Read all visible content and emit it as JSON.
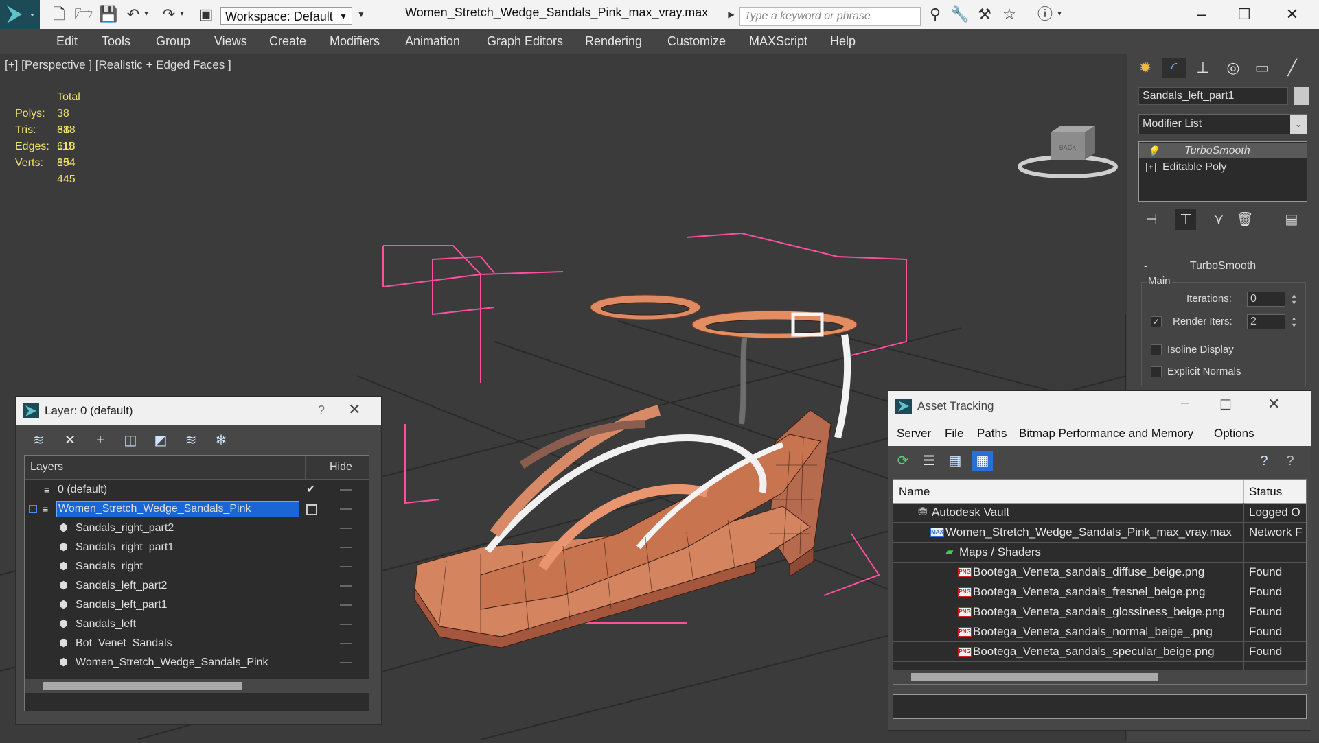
{
  "titlebar": {
    "workspace": "Workspace: Default",
    "file_title": "Women_Stretch_Wedge_Sandals_Pink_max_vray.max",
    "search_placeholder": "Type a keyword or phrase"
  },
  "menu": [
    "Edit",
    "Tools",
    "Group",
    "Views",
    "Create",
    "Modifiers",
    "Animation",
    "Graph Editors",
    "Rendering",
    "Customize",
    "MAXScript",
    "Help"
  ],
  "viewport": {
    "label": "[+] [Perspective ] [Realistic + Edged Faces ]",
    "viewcube_face": "BACK",
    "stats": {
      "header": "Total",
      "rows": [
        {
          "label": "Polys:",
          "value": "38 618"
        },
        {
          "label": "Tris:",
          "value": "38 618"
        },
        {
          "label": "Edges:",
          "value": "115 854"
        },
        {
          "label": "Verts:",
          "value": "19 445"
        }
      ]
    }
  },
  "command_panel": {
    "object_name": "Sandals_left_part1",
    "modifier_list": "Modifier List",
    "stack": [
      "TurboSmooth",
      "Editable Poly"
    ],
    "rollout_title": "TurboSmooth",
    "group_main": "Main",
    "iterations_label": "Iterations:",
    "iterations_value": "0",
    "render_iters_label": "Render Iters:",
    "render_iters_value": "2",
    "isoline_label": "Isoline Display",
    "explicit_normals_label": "Explicit Normals"
  },
  "layer_dialog": {
    "title": "Layer: 0 (default)",
    "help": "?",
    "col_layers": "Layers",
    "col_hide": "Hide",
    "rows": [
      {
        "name": "0 (default)",
        "level": 0,
        "selected": false
      },
      {
        "name": "Women_Stretch_Wedge_Sandals_Pink",
        "level": 0,
        "selected": true
      },
      {
        "name": "Sandals_right_part2",
        "level": 1,
        "selected": false
      },
      {
        "name": "Sandals_right_part1",
        "level": 1,
        "selected": false
      },
      {
        "name": "Sandals_right",
        "level": 1,
        "selected": false
      },
      {
        "name": "Sandals_left_part2",
        "level": 1,
        "selected": false
      },
      {
        "name": "Sandals_left_part1",
        "level": 1,
        "selected": false
      },
      {
        "name": "Sandals_left",
        "level": 1,
        "selected": false
      },
      {
        "name": "Bot_Venet_Sandals",
        "level": 1,
        "selected": false
      },
      {
        "name": "Women_Stretch_Wedge_Sandals_Pink",
        "level": 1,
        "selected": false
      }
    ]
  },
  "asset_dialog": {
    "title": "Asset Tracking",
    "menu": [
      "Server",
      "File",
      "Paths",
      "Bitmap Performance and Memory",
      "Options"
    ],
    "col_name": "Name",
    "col_status": "Status",
    "rows": [
      {
        "name": "Autodesk Vault",
        "status": "Logged O",
        "kind": "vault"
      },
      {
        "name": "Women_Stretch_Wedge_Sandals_Pink_max_vray.max",
        "status": "Network F",
        "kind": "max"
      },
      {
        "name": "Maps / Shaders",
        "status": "",
        "kind": "folder"
      },
      {
        "name": "Bootega_Veneta_sandals_diffuse_beige.png",
        "status": "Found",
        "kind": "png"
      },
      {
        "name": "Bootega_Veneta_sandals_fresnel_beige.png",
        "status": "Found",
        "kind": "png"
      },
      {
        "name": "Bootega_Veneta_sandals_glossiness_beige.png",
        "status": "Found",
        "kind": "png"
      },
      {
        "name": "Bootega_Veneta_sandals_normal_beige_.png",
        "status": "Found",
        "kind": "png"
      },
      {
        "name": "Bootega_Veneta_sandals_specular_beige.png",
        "status": "Found",
        "kind": "png"
      }
    ]
  },
  "icons": {
    "png_badge": "PNG",
    "max_badge": "MAX"
  },
  "colors": {
    "accent_blue": "#1f6fd1",
    "selection_blue": "#1b66d6",
    "wire_orange": "#e88a55",
    "bbox_pink": "#ff4fa0",
    "stats_yellow": "#f0e16a"
  }
}
